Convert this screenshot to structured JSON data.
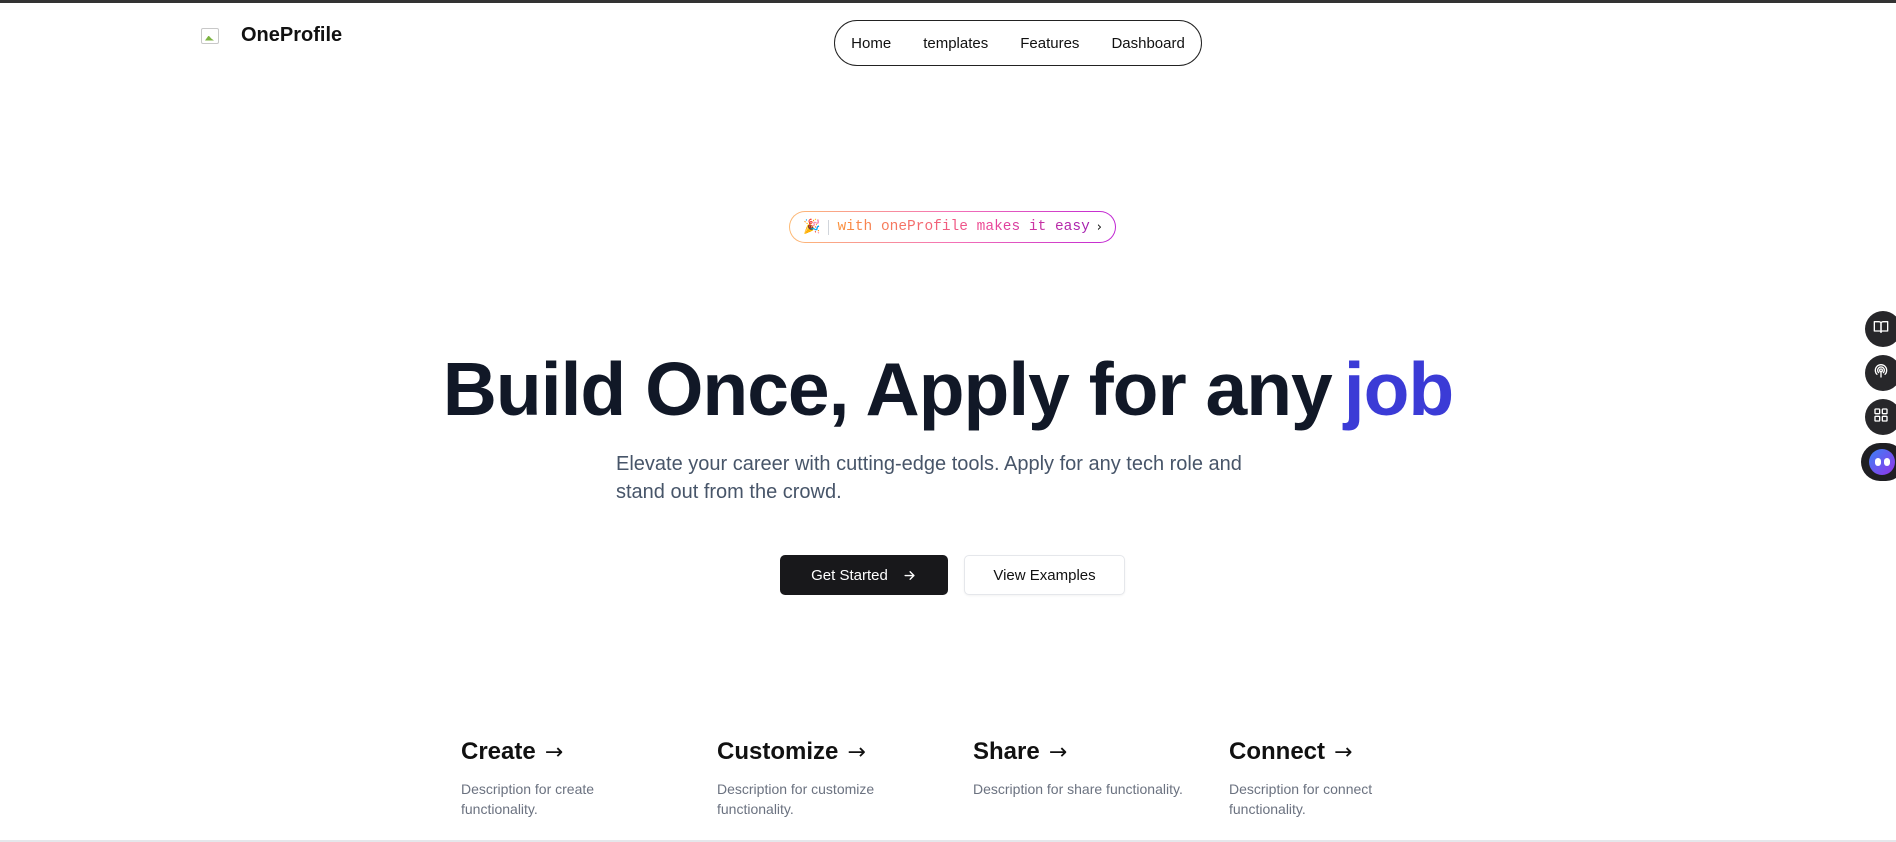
{
  "header": {
    "brand": "OneProfile",
    "nav": [
      "Home",
      "templates",
      "Features",
      "Dashboard"
    ]
  },
  "badge": {
    "emoji": "🎉",
    "text": "with oneProfile makes it easy",
    "chevron": "›"
  },
  "hero": {
    "title_main": "Build Once, Apply for any",
    "title_accent": "job",
    "subtitle": "Elevate your career with cutting-edge tools. Apply for any tech role and stand out from the crowd."
  },
  "buttons": {
    "primary": "Get Started",
    "secondary": "View Examples"
  },
  "features": [
    {
      "title": "Create",
      "arrow": "→",
      "desc": "Description for create functionality."
    },
    {
      "title": "Customize",
      "arrow": "→",
      "desc": "Description for customize functionality."
    },
    {
      "title": "Share",
      "arrow": "→",
      "desc": "Description for share functionality."
    },
    {
      "title": "Connect",
      "arrow": "→",
      "desc": "Description for connect functionality."
    }
  ],
  "side_tools": [
    "book-icon",
    "broadcast-icon",
    "apps-grid-icon",
    "assistant-bot-icon"
  ],
  "colors": {
    "accent": "#3b3bd6",
    "primary_button": "#18181b",
    "badge_gradient": [
      "#fb923c",
      "#ec4899",
      "#a21caf"
    ]
  }
}
